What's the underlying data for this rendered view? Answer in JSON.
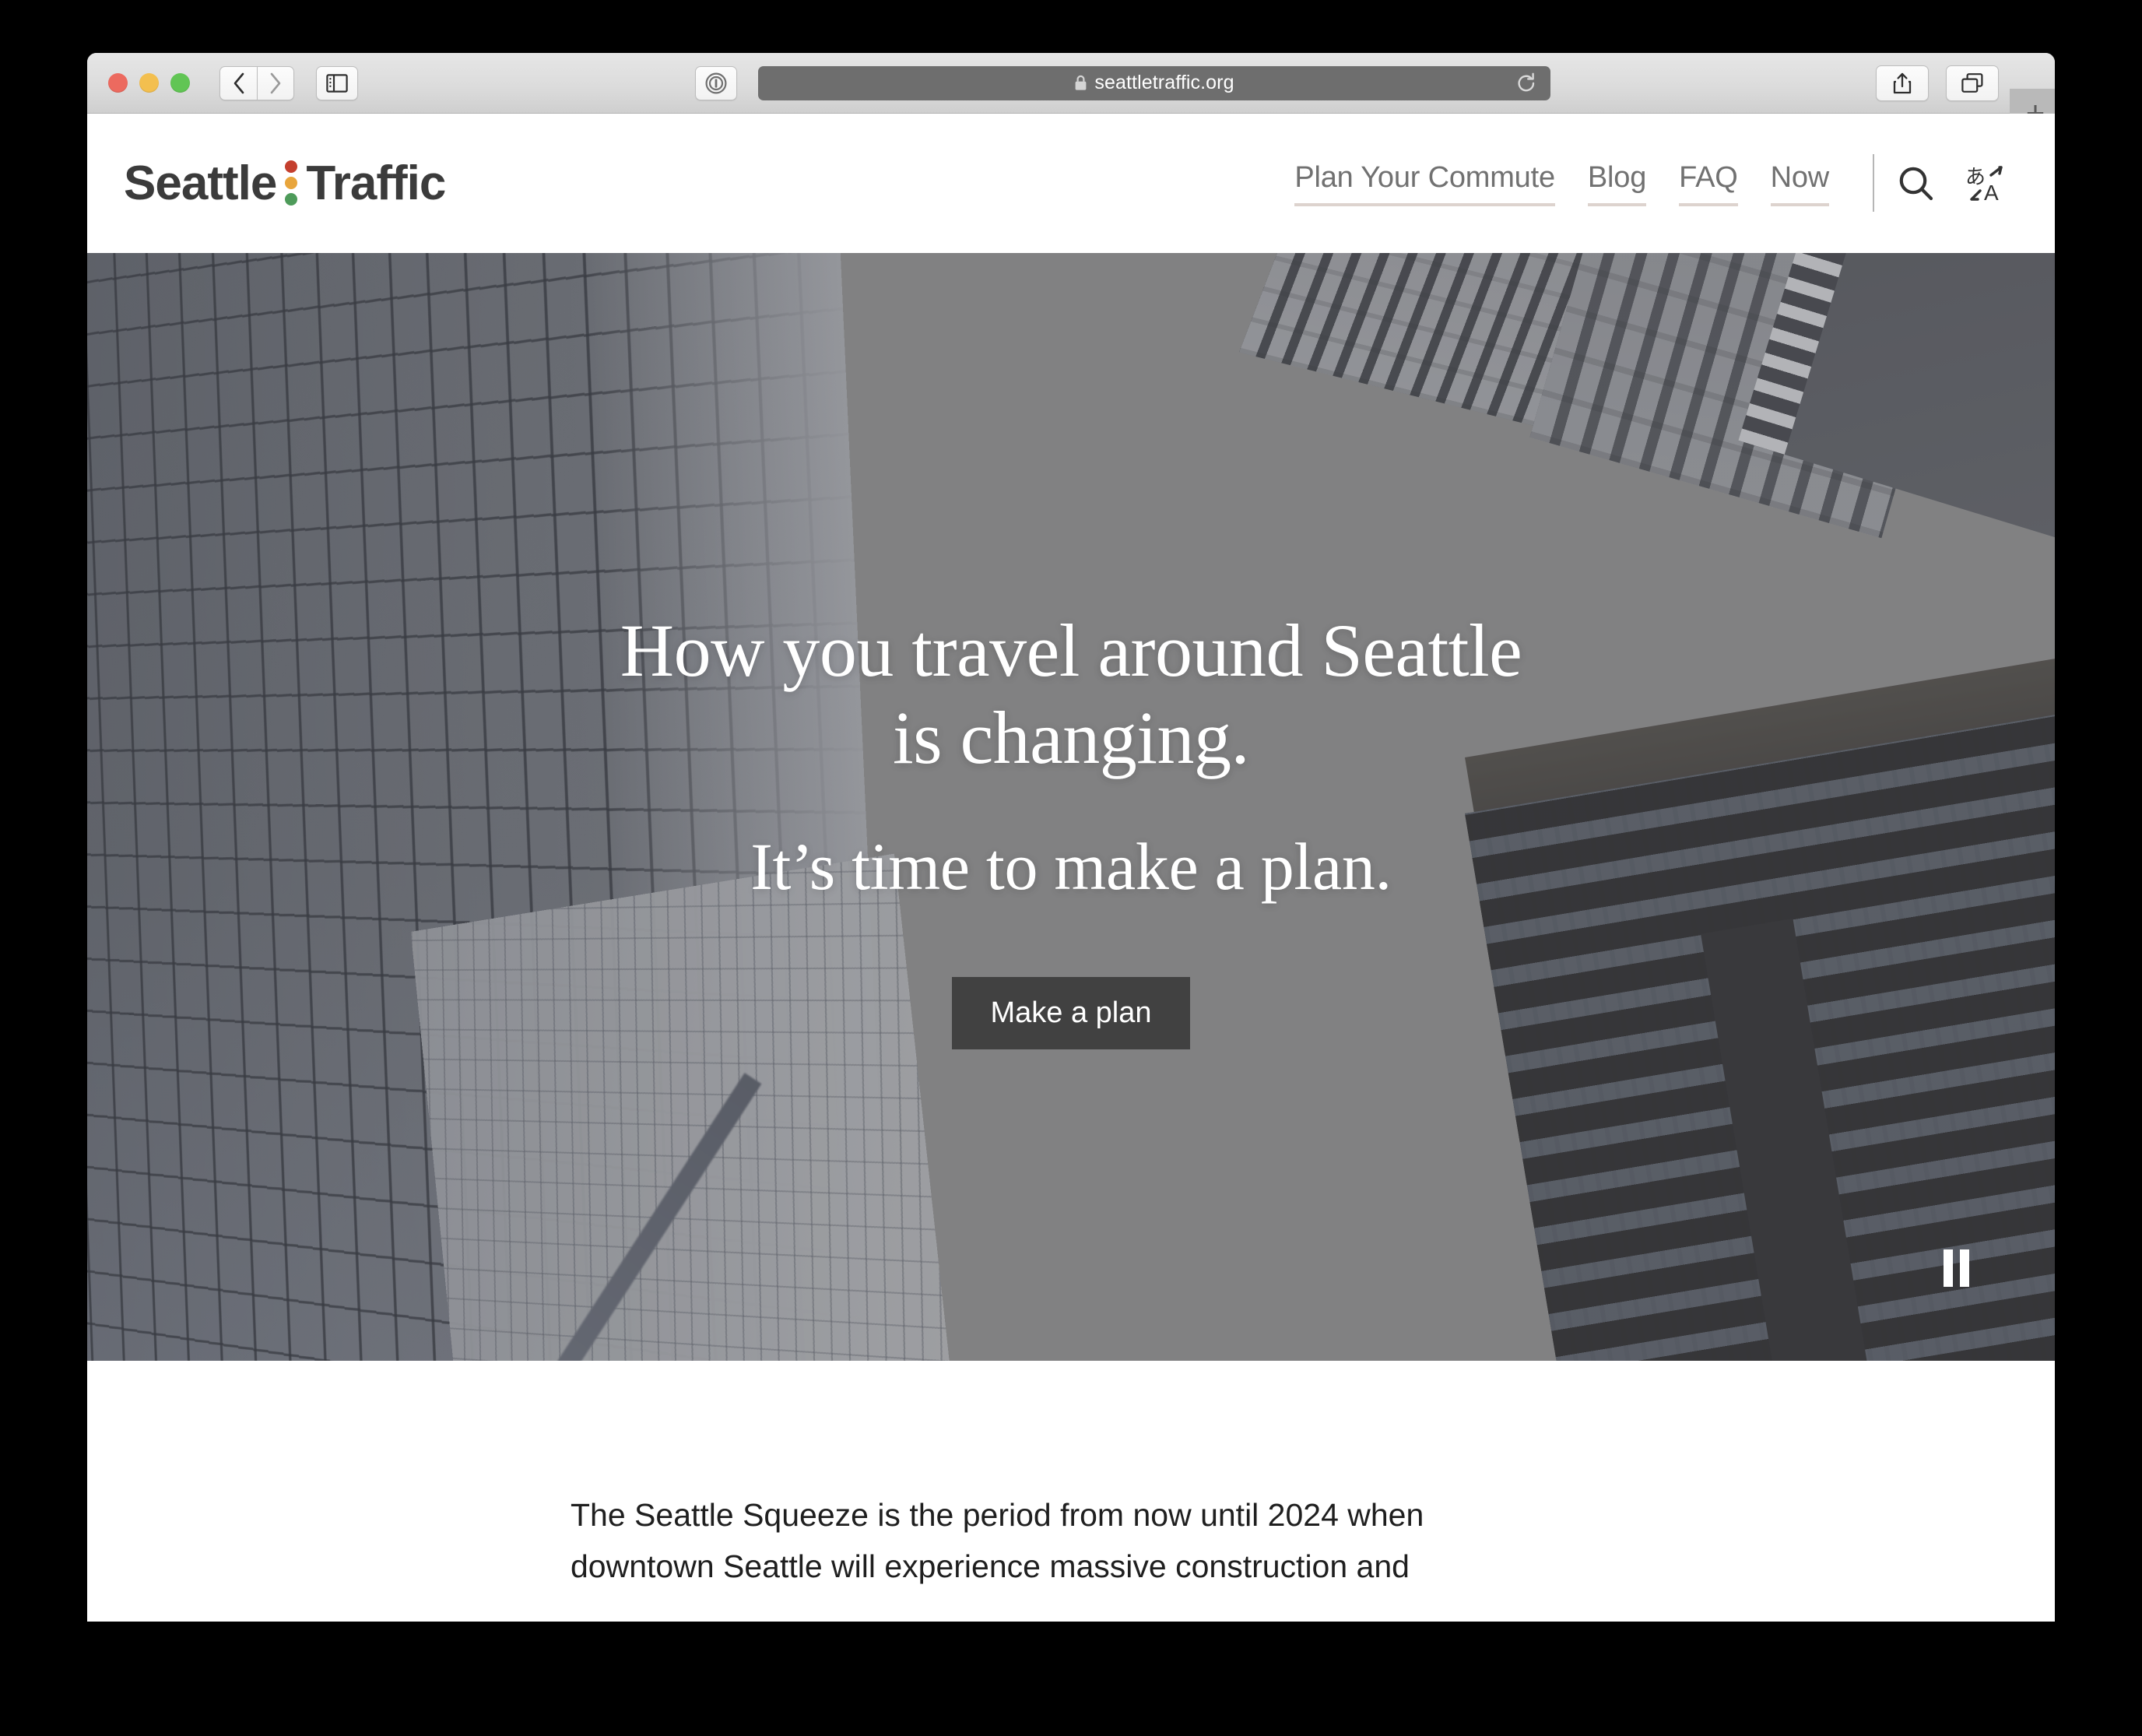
{
  "browser": {
    "url": "seattletraffic.org",
    "window_controls": {
      "close": "close",
      "minimize": "minimize",
      "maximize": "maximize"
    },
    "toolbar": {
      "back_label": "Back",
      "forward_label": "Forward",
      "sidebar_label": "Show Sidebar",
      "privacy_label": "Privacy Report",
      "reload_label": "Reload",
      "share_label": "Share",
      "tab_overview_label": "Tab Overview",
      "new_tab_label": "+"
    }
  },
  "site": {
    "logo": {
      "word_one": "Seattle",
      "word_two": "Traffic",
      "dot_colors": [
        "#c43f2e",
        "#e8a53c",
        "#4e9b5a"
      ],
      "text_color": "#3b3b3b"
    },
    "nav": {
      "items": [
        {
          "label": "Plan Your Commute"
        },
        {
          "label": "Blog"
        },
        {
          "label": "FAQ"
        },
        {
          "label": "Now"
        }
      ],
      "underline_color": "#ddd3ce",
      "text_color": "#717171"
    },
    "header_icons": [
      {
        "name": "search-icon",
        "label": "Search"
      },
      {
        "name": "translate-icon",
        "label": "Translate"
      }
    ]
  },
  "hero": {
    "headline_line_1": "How you travel around Seattle",
    "headline_line_2": "is changing.",
    "subheadline": "It’s time to make a plan.",
    "cta_label": "Make a plan",
    "cta_color": "#414141",
    "pause_label": "Pause background video",
    "text_color": "#ffffff"
  },
  "intro": {
    "paragraph": "The Seattle Squeeze is the period from now until 2024 when downtown Seattle will experience massive construction and"
  }
}
